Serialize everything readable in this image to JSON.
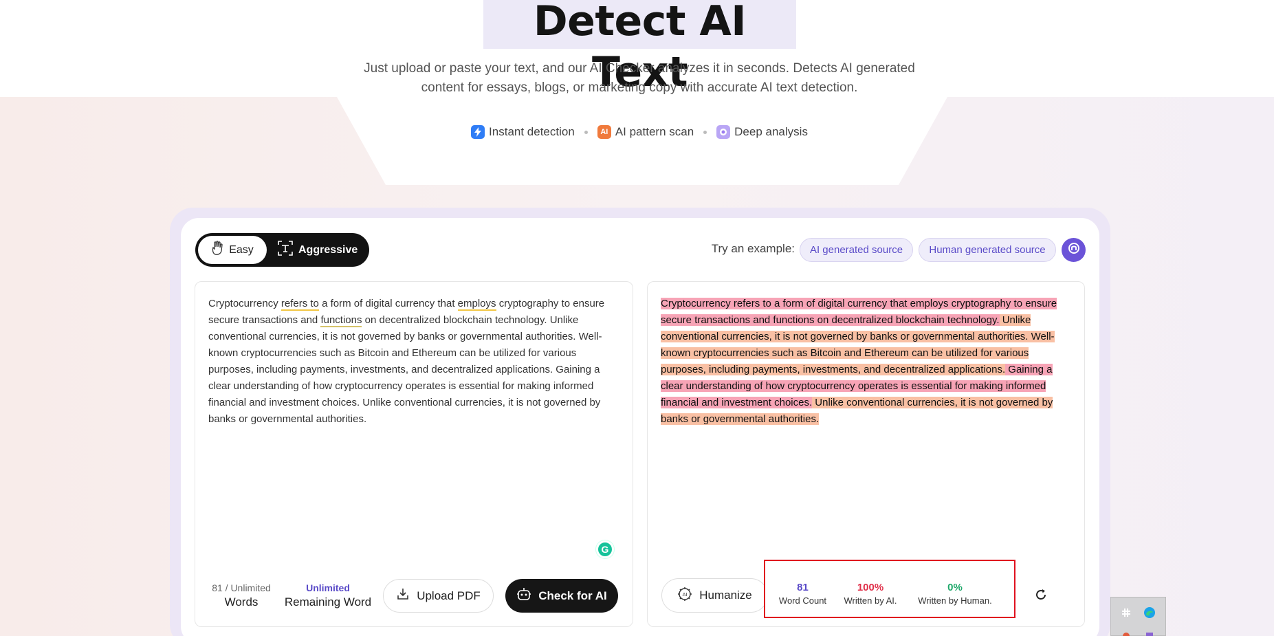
{
  "hero": {
    "title": "Detect AI Text",
    "subtitle_line1": "Just upload or paste your text, and our AI Checker analyzes it in seconds. Detects AI generated",
    "subtitle_line2": "content for essays, blogs, or marketing copy with accurate AI text detection.",
    "features": [
      {
        "label": "Instant detection",
        "icon": "lightning-icon",
        "color": "#2f7df6"
      },
      {
        "label": "AI pattern scan",
        "icon": "ai-badge-icon",
        "color": "#f07a3c"
      },
      {
        "label": "Deep analysis",
        "icon": "brain-icon",
        "color": "#9b7cf0"
      }
    ]
  },
  "modes": {
    "easy_label": "Easy",
    "aggressive_label": "Aggressive",
    "selected": "Easy"
  },
  "examples": {
    "try_label": "Try an example:",
    "ai_label": "AI generated source",
    "human_label": "Human generated source"
  },
  "input": {
    "segments": [
      "Cryptocurrency ",
      "refers to",
      " a form of digital currency that ",
      "employs",
      " cryptography to ensure secure transactions and ",
      "functions",
      " on decentralized blockchain technology. Unlike conventional currencies, it is not governed by banks or governmental authorities. Well-known cryptocurrencies such as Bitcoin and Ethereum can be utilized for various purposes, including payments, investments, and decentralized applications. Gaining a clear understanding of how cryptocurrency operates is essential for making informed financial and investment choices. Unlike conventional currencies, it is not governed by banks or governmental authorities."
    ],
    "word_count_label": "81 / Unlimited",
    "word_count_sub": "Words",
    "remaining_label": "Unlimited",
    "remaining_sub": "Remaining Word",
    "upload_label": "Upload PDF",
    "check_label": "Check for AI"
  },
  "output": {
    "sentences": [
      {
        "text": "Cryptocurrency refers to a form of digital currency that employs cryptography to ensure secure transactions and functions on decentralized blockchain technology.",
        "level": "pink"
      },
      {
        "text": " Unlike conventional currencies, it is not governed by banks or governmental authorities.",
        "level": "orange"
      },
      {
        "text": " Well-known cryptocurrencies such as Bitcoin and Ethereum can be utilized for various purposes, including payments, investments, and decentralized applications.",
        "level": "orange"
      },
      {
        "text": " Gaining a clear understanding of how cryptocurrency operates is essential for making informed financial and investment choices.",
        "level": "pink"
      },
      {
        "text": " Unlike conventional currencies, it is not governed by banks or governmental authorities.",
        "level": "orange"
      }
    ],
    "humanize_label": "Humanize",
    "stats": {
      "word_count_value": "81",
      "word_count_label": "Word Count",
      "ai_value": "100%",
      "ai_label": "Written by AI.",
      "human_value": "0%",
      "human_label": "Written by Human."
    }
  },
  "colors": {
    "accent": "#5a4bc8",
    "ai_red": "#e0304a",
    "human_green": "#1fa86a",
    "highlight_pink": "#f7a4b6",
    "highlight_orange": "#f9c0a4"
  }
}
